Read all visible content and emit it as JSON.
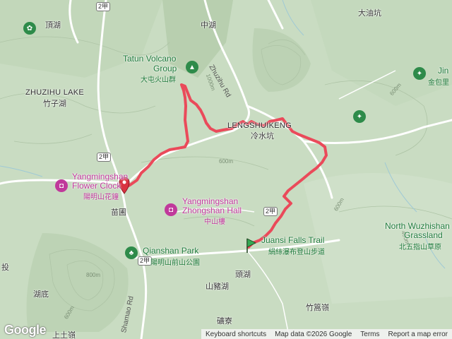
{
  "map": {
    "labels": {
      "dinghu": "頂湖",
      "zhuzihu_en": "ZHUZIHU LAKE",
      "zhuzihu_zh": "竹子湖",
      "zhonghu": "中湖",
      "datun_en_1": "Tatun Volcano",
      "datun_en_2": "Group",
      "datun_zh": "大屯火山群",
      "zhuzihu_rd": "Zhuzihu Rd",
      "lengshui_en": "LENGSHUIKENG",
      "lengshui_zh": "冷水坑",
      "dayoukeng": "大油坑",
      "jinbao_en": "Jin",
      "jinbao_zh": "金包里",
      "flower_en_1": "Yangmingshan",
      "flower_en_2": "Flower Clock",
      "flower_zh": "陽明山花鐘",
      "miaopu": "苗圃",
      "zhongshan_en_1": "Yangmingshan",
      "zhongshan_en_2": "Zhongshan Hall",
      "zhongshan_zh": "中山樓",
      "qianshan_en": "Qianshan Park",
      "qianshan_zh": "陽明山前山公園",
      "juansi_en": "Juansi Falls Trail",
      "juansi_zh": "絹絲瀑布登山步道",
      "touhu": "頭湖",
      "shanzhuhu": "山豬湖",
      "wuzhishan_en_1": "North Wuzhishan",
      "wuzhishan_en_2": "Grassland",
      "wuzhishan_zh": "北五指山草原",
      "zhuhaoling": "竹篙嶺",
      "tou": "投",
      "hudi": "湖底",
      "shangtuling": "上土嶺",
      "shiliao": "礦寮",
      "shamao_rd": "Shamao Rd"
    },
    "shields": [
      "2甲",
      "2甲",
      "2甲",
      "2甲"
    ],
    "contours": [
      "600m",
      "1000m",
      "600m",
      "800m",
      "600m",
      "400m",
      "600m"
    ],
    "colors": {
      "route": "#ea4a5a",
      "terrain": "#c9dcc2",
      "poi": "#c0399b",
      "park": "#1e7a3a",
      "road": "#ffffff"
    }
  },
  "footer": {
    "logo": "Google",
    "shortcuts": "Keyboard shortcuts",
    "mapdata": "Map data ©2026 Google",
    "terms": "Terms",
    "report": "Report a map error"
  }
}
